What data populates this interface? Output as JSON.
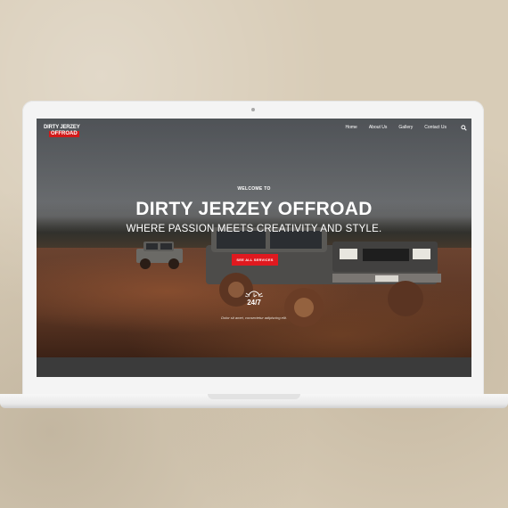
{
  "logo": {
    "line1": "DIRTY JERZEY",
    "line2": "OFFROAD"
  },
  "nav": {
    "items": [
      {
        "label": "Home"
      },
      {
        "label": "About Us"
      },
      {
        "label": "Gallery"
      },
      {
        "label": "Contact Us"
      }
    ],
    "search_icon": "search-icon"
  },
  "hero": {
    "welcome": "WELCOME TO",
    "headline": "DIRTY JERZEY OFFROAD",
    "subline": "WHERE PASSION MEETS CREATIVITY AND STYLE.",
    "cta_label": "SEE ALL SERVICES",
    "badge_icon": "clock-wings-icon",
    "badge_text": "24/7",
    "caption": "Dolor sit amet, consectetur adipiscing elit."
  },
  "colors": {
    "accent": "#e0191f",
    "background": "#d8ccb7",
    "laptop": "#f4f4f4"
  }
}
